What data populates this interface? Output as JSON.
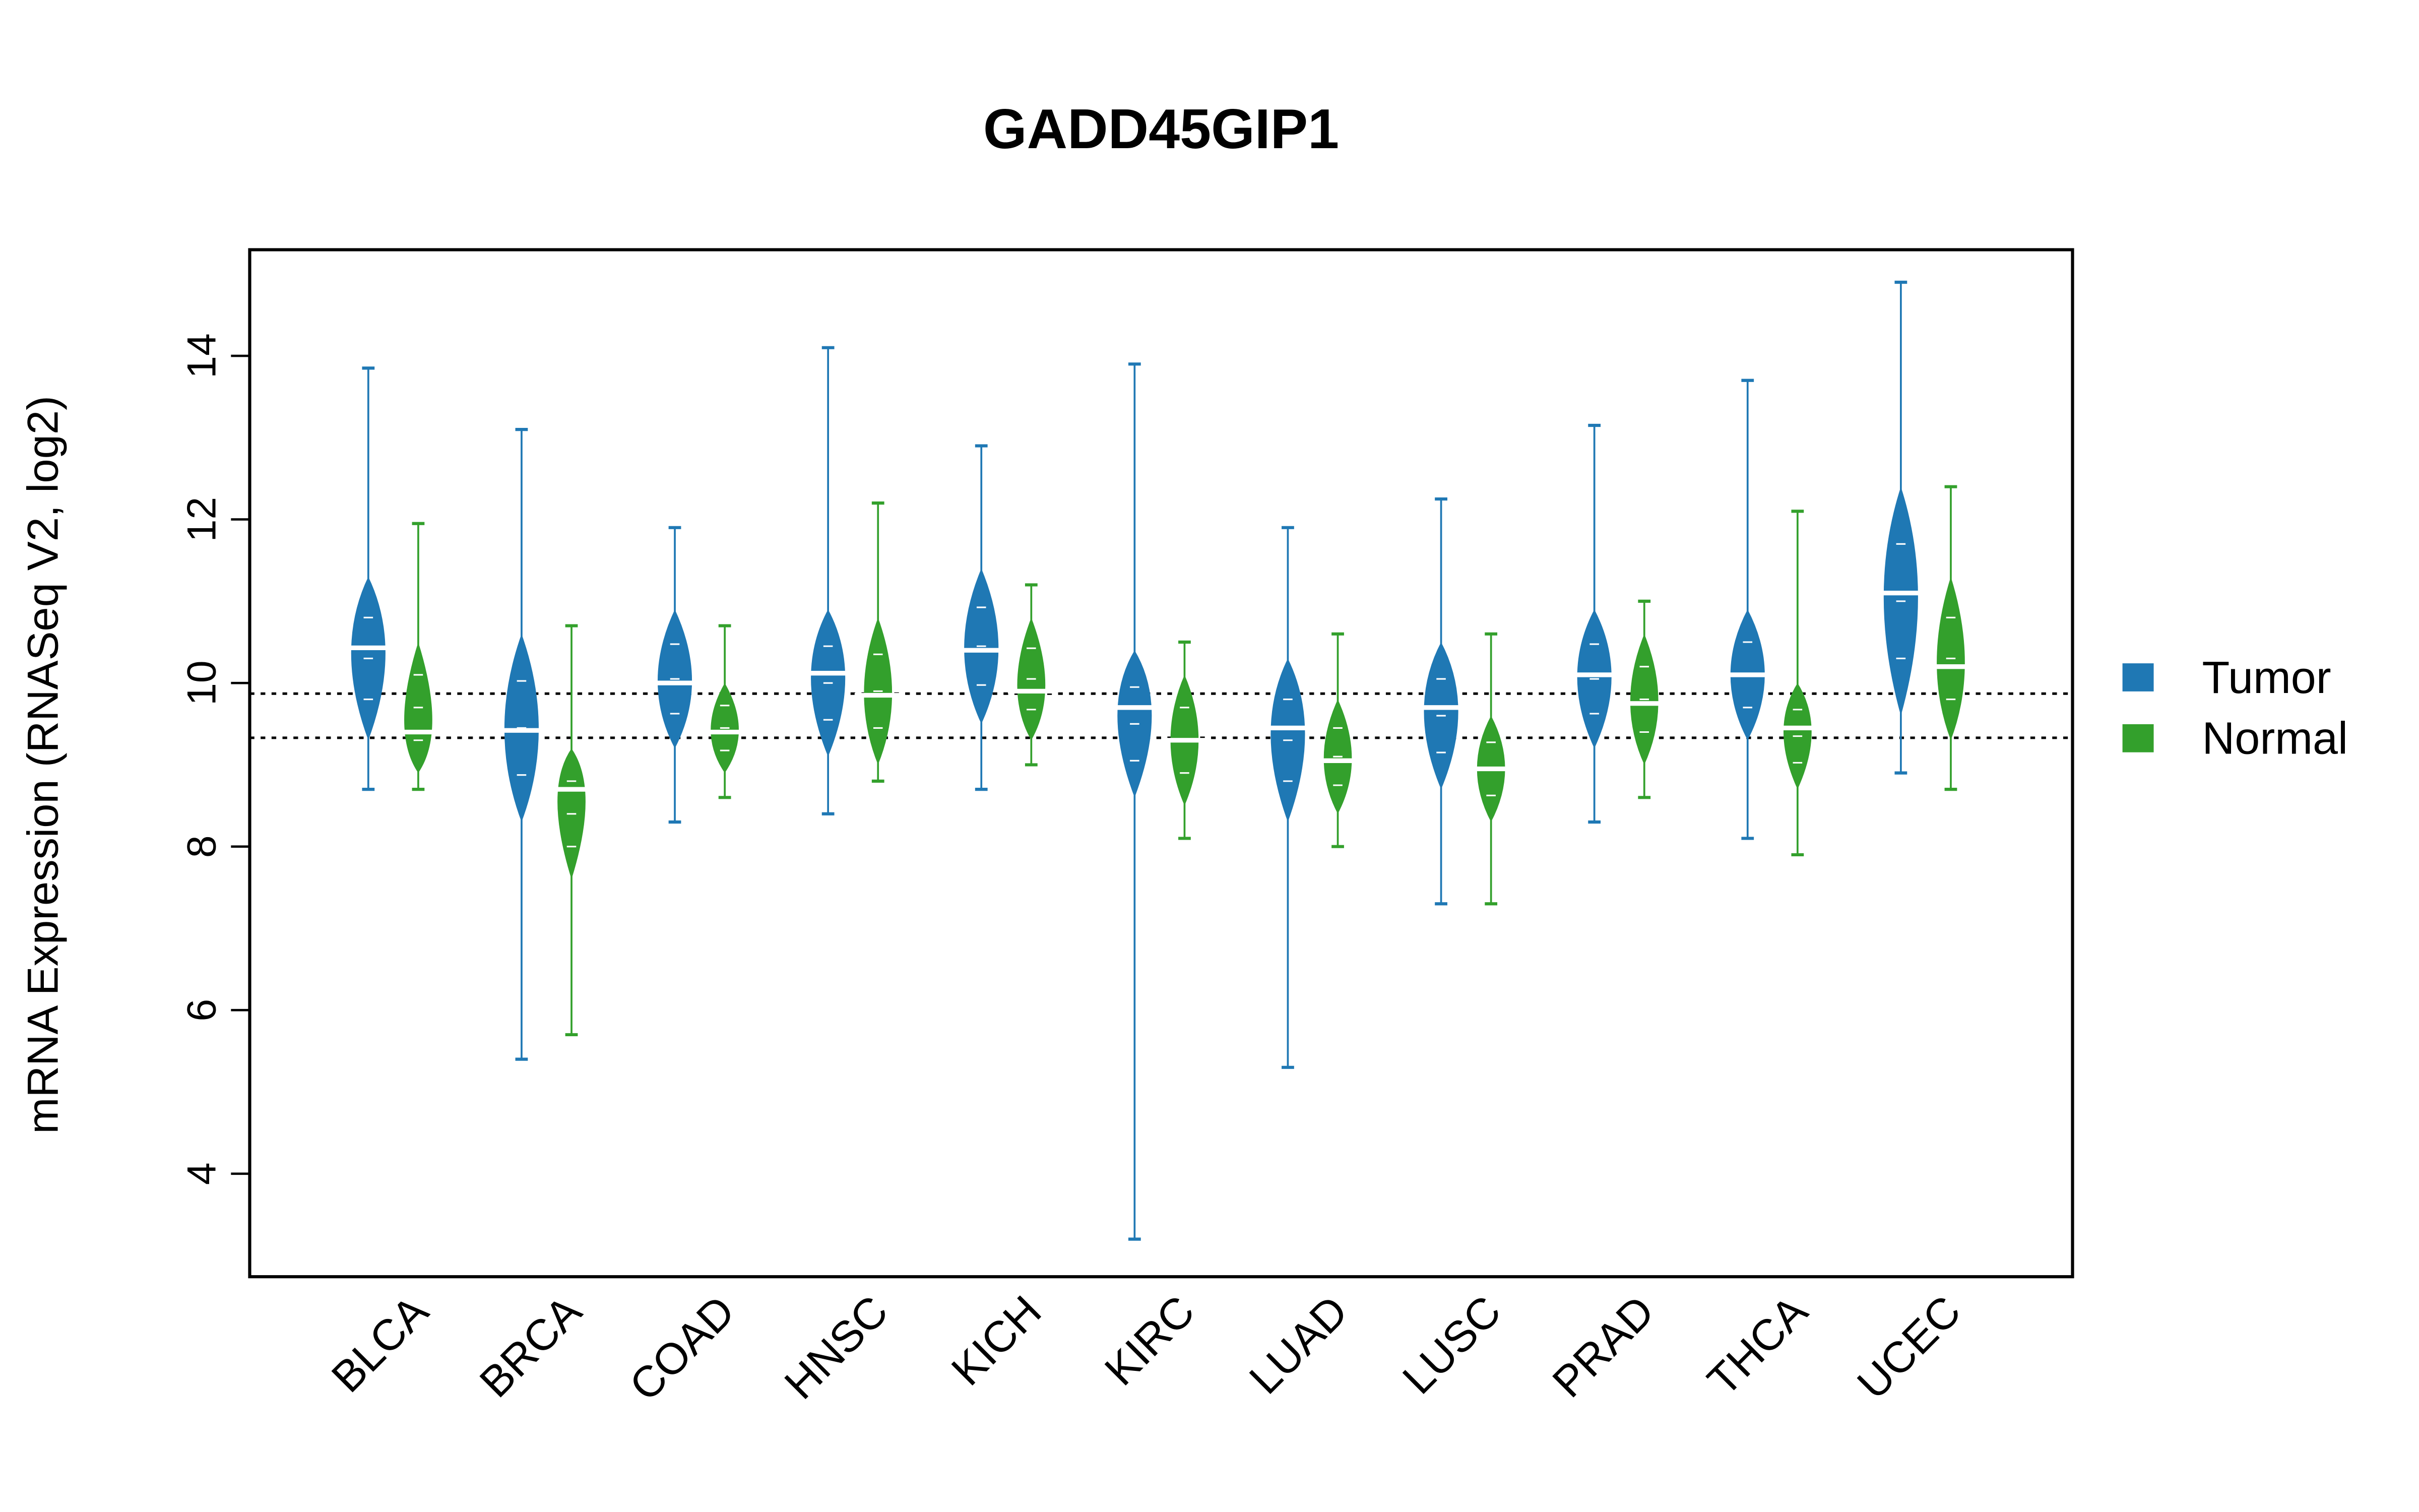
{
  "chart_data": {
    "type": "beanplot",
    "title": "GADD45GIP1",
    "ylabel": "mRNA Expression (RNASeq V2, log2)",
    "xlabel": "",
    "ylim": [
      2.8,
      15.3
    ],
    "yticks": [
      4,
      6,
      8,
      10,
      12,
      14
    ],
    "grid": false,
    "legend_placement": "right",
    "reference_lines": [
      9.87,
      9.33
    ],
    "categories": [
      "BLCA",
      "BRCA",
      "COAD",
      "HNSC",
      "KICH",
      "KIRC",
      "LUAD",
      "LUSC",
      "PRAD",
      "THCA",
      "UCEC"
    ],
    "series": [
      {
        "name": "Tumor",
        "color": "#1f78b4",
        "median": [
          10.43,
          9.42,
          10.0,
          10.12,
          10.4,
          9.7,
          9.45,
          9.7,
          10.1,
          10.1,
          11.1
        ],
        "body_low": [
          9.3,
          8.3,
          9.2,
          9.1,
          9.5,
          8.6,
          8.3,
          8.7,
          9.2,
          9.3,
          9.6
        ],
        "body_high": [
          11.3,
          10.6,
          10.9,
          10.9,
          11.4,
          10.4,
          10.3,
          10.5,
          10.9,
          10.9,
          12.4
        ],
        "min": [
          8.7,
          5.4,
          8.3,
          8.4,
          8.7,
          3.2,
          5.3,
          7.3,
          8.3,
          8.1,
          8.9
        ],
        "max": [
          13.85,
          13.1,
          11.9,
          14.1,
          12.9,
          13.9,
          11.9,
          12.25,
          13.15,
          13.7,
          14.9
        ]
      },
      {
        "name": "Normal",
        "color": "#33a02c",
        "median": [
          9.4,
          8.7,
          9.4,
          9.85,
          9.9,
          9.3,
          9.05,
          8.95,
          9.75,
          9.45,
          10.2
        ],
        "body_low": [
          8.9,
          7.6,
          8.9,
          9.0,
          9.3,
          8.5,
          8.4,
          8.3,
          9.0,
          8.7,
          9.3
        ],
        "body_high": [
          10.5,
          9.2,
          10.0,
          10.8,
          10.8,
          10.1,
          9.8,
          9.6,
          10.6,
          10.0,
          11.3
        ],
        "min": [
          8.7,
          5.7,
          8.6,
          8.8,
          9.0,
          8.1,
          8.0,
          7.3,
          8.6,
          7.9,
          8.7
        ],
        "max": [
          11.95,
          10.7,
          10.7,
          12.2,
          11.2,
          10.5,
          10.6,
          10.6,
          11.0,
          12.1,
          12.4
        ]
      }
    ]
  }
}
